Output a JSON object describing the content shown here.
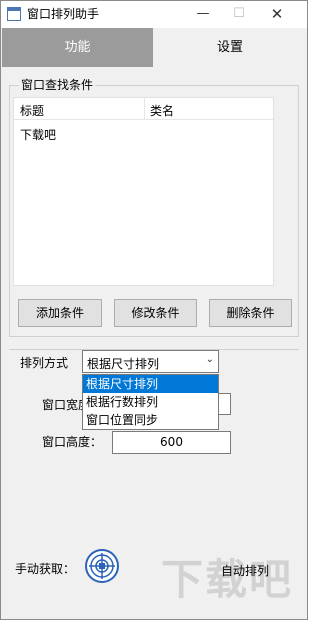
{
  "window": {
    "title": "窗口排列助手",
    "min_glyph": "—",
    "max_glyph": "☐",
    "close_glyph": "✕"
  },
  "tabs": [
    {
      "label": "功能",
      "active": true
    },
    {
      "label": "设置",
      "active": false
    }
  ],
  "find_group": {
    "label": "窗口查找条件",
    "columns": [
      "标题",
      "类名"
    ],
    "rows": [
      [
        "下载吧",
        ""
      ]
    ]
  },
  "buttons": {
    "add": "添加条件",
    "modify": "修改条件",
    "delete": "删除条件"
  },
  "arrange": {
    "label": "排列方式",
    "selected": "根据尺寸排列",
    "arrow": "⌄",
    "options": [
      "根据尺寸排列",
      "根据行数排列",
      "窗口位置同步"
    ]
  },
  "size": {
    "width_label": "窗口宽度：",
    "width_value": "",
    "height_label": "窗口高度：",
    "height_value": "600"
  },
  "footer": {
    "manual_label": "手动获取：",
    "auto_label": "自动排列",
    "watermark": "下载吧"
  },
  "colors": {
    "active_tab": "#9b9b9b",
    "selection": "#0078d7",
    "target_icon": "#2b63b8"
  },
  "icons": {
    "app": "window-icon",
    "target": "crosshair-icon"
  }
}
